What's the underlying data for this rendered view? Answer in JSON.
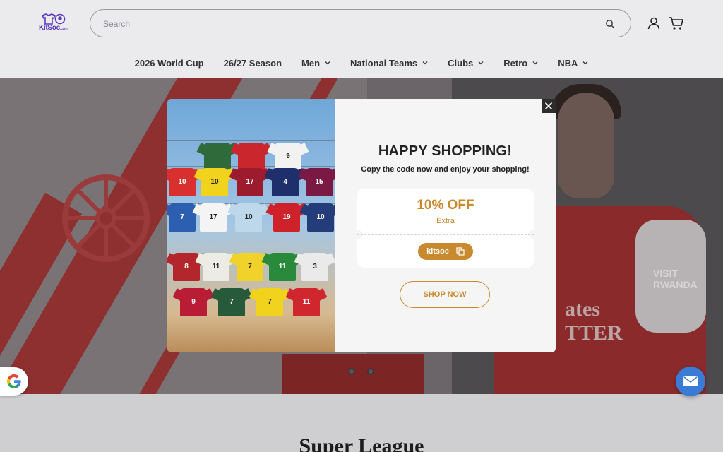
{
  "header": {
    "logo_text": "KitSoc",
    "logo_suffix": ".com",
    "search_placeholder": "Search"
  },
  "nav": {
    "items": [
      {
        "label": "2026 World Cup",
        "has_dropdown": false
      },
      {
        "label": "26/27 Season",
        "has_dropdown": false
      },
      {
        "label": "Men",
        "has_dropdown": true
      },
      {
        "label": "National Teams",
        "has_dropdown": true
      },
      {
        "label": "Clubs",
        "has_dropdown": true
      },
      {
        "label": "Retro",
        "has_dropdown": true
      },
      {
        "label": "NBA",
        "has_dropdown": true
      }
    ]
  },
  "hero": {
    "shirt_text": "ates",
    "shirt_text_2": "TTER",
    "sponsor_line1": "VISIT",
    "sponsor_line2": "RWANDA"
  },
  "modal": {
    "title": "HAPPY SHOPPING!",
    "subtitle": "Copy the code now and enjoy your shopping!",
    "discount": "10% OFF",
    "discount_note": "Extra",
    "code": "kitsoc",
    "cta": "SHOP NOW",
    "accent_color": "#c98a2e"
  },
  "jerseys": [
    {
      "color": "#2f6b3a",
      "num": ""
    },
    {
      "color": "#c9262d",
      "num": ""
    },
    {
      "color": "#f2f2f2",
      "num": "9"
    },
    {
      "color": "#d8302f",
      "num": "10"
    },
    {
      "color": "#f1d21c",
      "num": "10"
    },
    {
      "color": "#9c1c2e",
      "num": "17"
    },
    {
      "color": "#1f2f6b",
      "num": "4"
    },
    {
      "color": "#7a1a44",
      "num": "15"
    },
    {
      "color": "#2c5fb0",
      "num": "7"
    },
    {
      "color": "#f4f4f4",
      "num": "17"
    },
    {
      "color": "#bcd8ea",
      "num": "10"
    },
    {
      "color": "#cf2129",
      "num": "19"
    },
    {
      "color": "#243c7a",
      "num": "10"
    },
    {
      "color": "#b3262c",
      "num": "8"
    },
    {
      "color": "#ecece4",
      "num": "11"
    },
    {
      "color": "#f0d22a",
      "num": "7"
    },
    {
      "color": "#2a8a3c",
      "num": "11"
    },
    {
      "color": "#eaeaea",
      "num": "3"
    },
    {
      "color": "#b81d35",
      "num": "9"
    },
    {
      "color": "#275a3a",
      "num": "7"
    },
    {
      "color": "#f1d21c",
      "num": "7"
    },
    {
      "color": "#d0262e",
      "num": "11"
    }
  ],
  "section": {
    "title": "Super League"
  }
}
